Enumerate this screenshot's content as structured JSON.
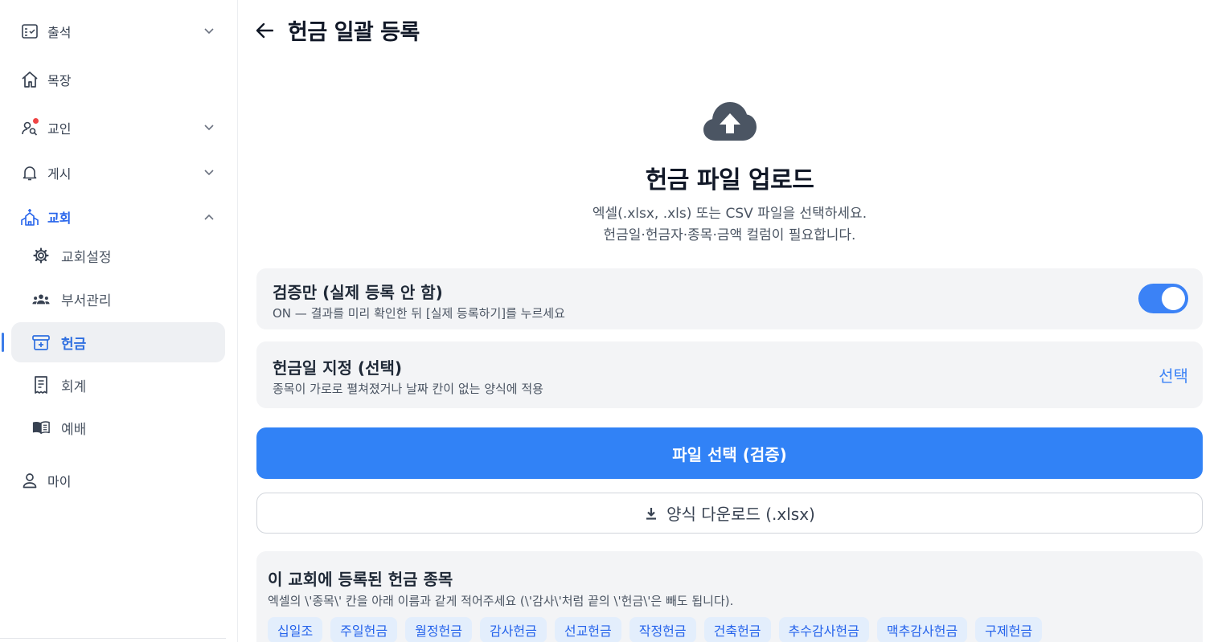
{
  "sidebar": {
    "items": [
      {
        "label": "출석"
      },
      {
        "label": "목장"
      },
      {
        "label": "교인"
      },
      {
        "label": "게시"
      },
      {
        "label": "교회"
      },
      {
        "label": "교회설정"
      },
      {
        "label": "부서관리"
      },
      {
        "label": "헌금"
      },
      {
        "label": "회계"
      },
      {
        "label": "예배"
      },
      {
        "label": "마이"
      }
    ]
  },
  "header": {
    "title": "헌금 일괄 등록"
  },
  "upload": {
    "title": "헌금 파일 업로드",
    "desc_line1": "엑셀(.xlsx, .xls) 또는 CSV 파일을 선택하세요.",
    "desc_line2": "헌금일·헌금자·종목·금액 컬럼이 필요합니다."
  },
  "validate_only": {
    "title": "검증만 (실제 등록 안 함)",
    "subtitle": "ON — 결과를 미리 확인한 뒤 [실제 등록하기]를 누르세요",
    "enabled": true
  },
  "date_setting": {
    "title": "헌금일 지정 (선택)",
    "subtitle": "종목이 가로로 펼쳐졌거나 날짜 칸이 없는 양식에 적용",
    "action": "선택"
  },
  "buttons": {
    "select_file": "파일 선택 (검증)",
    "download_template": "양식 다운로드 (.xlsx)"
  },
  "offering_types": {
    "title": "이 교회에 등록된 헌금 종목",
    "subtitle": "엑셀의 \\'종목\\' 칸을 아래 이름과 같게 적어주세요 (\\'감사\\'처럼 끝의 \\'헌금\\'은 빼도 됩니다).",
    "items": [
      "십일조",
      "주일헌금",
      "월정헌금",
      "감사헌금",
      "선교헌금",
      "작정헌금",
      "건축헌금",
      "추수감사헌금",
      "맥추감사헌금",
      "구제헌금"
    ]
  },
  "colors": {
    "accent": "#3182f6",
    "badge": "#ef4444"
  }
}
